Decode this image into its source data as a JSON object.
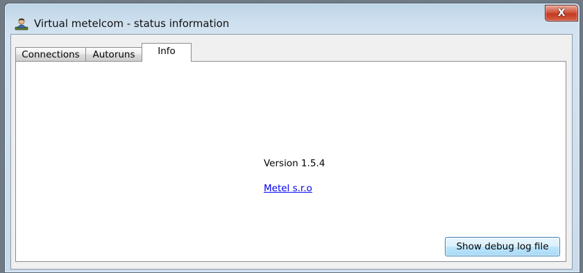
{
  "window": {
    "title": "Virtual metelcom - status information",
    "close_label": "X",
    "icon": "network-user-icon"
  },
  "tabs": [
    {
      "label": "Connections",
      "active": false
    },
    {
      "label": "Autoruns",
      "active": false
    },
    {
      "label": "Info",
      "active": true
    }
  ],
  "info": {
    "version": "Version 1.5.4",
    "company_link": "Metel s.r.o",
    "debug_button": "Show debug log file"
  },
  "colors": {
    "link": "#0000ee",
    "close_button": "#c43a20",
    "button_accent": "#3c7fb1"
  }
}
